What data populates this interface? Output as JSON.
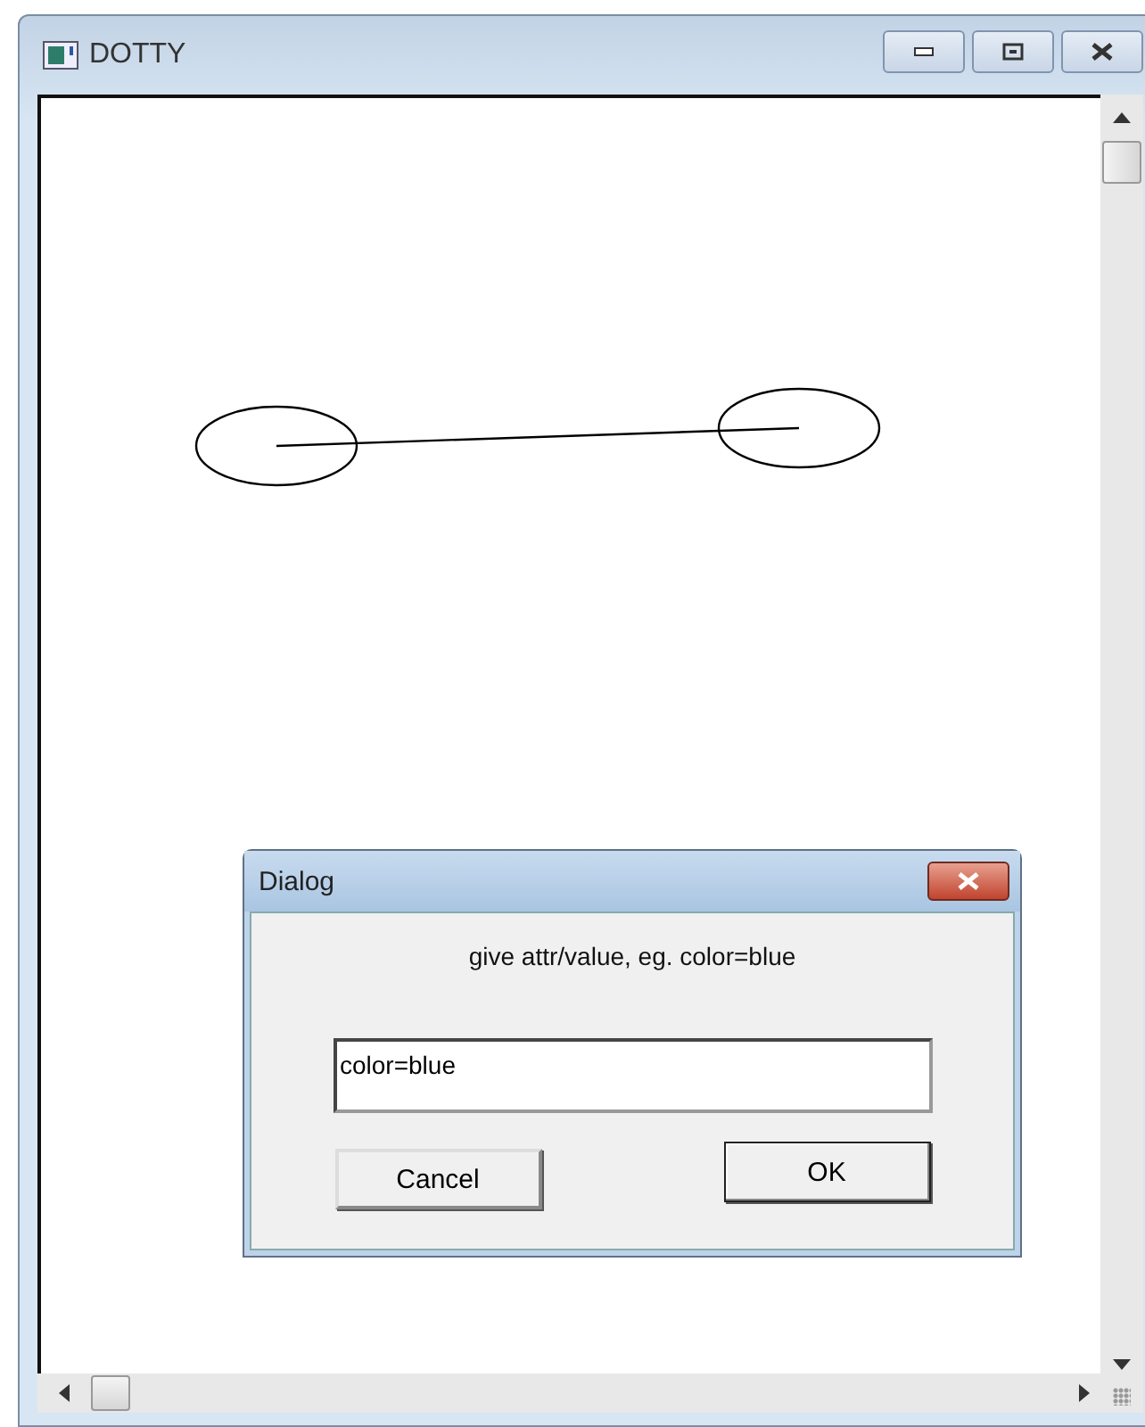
{
  "window": {
    "title": "DOTTY"
  },
  "graph": {
    "nodes": [
      {
        "kind": "ellipse"
      },
      {
        "kind": "ellipse"
      }
    ],
    "edges": [
      {
        "kind": "line"
      }
    ]
  },
  "dialog": {
    "title": "Dialog",
    "prompt": "give attr/value, eg. color=blue",
    "value": "color=blue",
    "buttons": [
      {
        "label": "Cancel",
        "default": false
      },
      {
        "label": "OK",
        "default": true
      }
    ]
  }
}
